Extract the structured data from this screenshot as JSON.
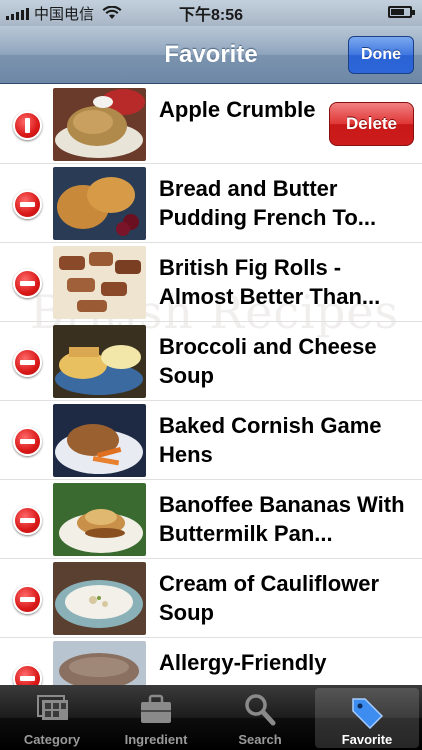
{
  "status_bar": {
    "carrier": "中国电信",
    "time": "下午8:56",
    "battery_level": 0.7
  },
  "nav": {
    "title": "Favorite",
    "done_label": "Done"
  },
  "watermark": "British Recipes",
  "list": {
    "delete_label": "Delete",
    "items": [
      {
        "title": "Apple Crumble"
      },
      {
        "title": "Bread and Butter Pudding French To..."
      },
      {
        "title": "British Fig Rolls - Almost Better Than..."
      },
      {
        "title": "Broccoli and Cheese Soup"
      },
      {
        "title": "Baked Cornish Game Hens"
      },
      {
        "title": "Banoffee Bananas With Buttermilk Pan..."
      },
      {
        "title": "Cream of Cauliflower Soup"
      },
      {
        "title": "Allergy-Friendly"
      }
    ]
  },
  "tabs": [
    {
      "label": "Category",
      "icon": "category-icon"
    },
    {
      "label": "Ingredient",
      "icon": "briefcase-icon"
    },
    {
      "label": "Search",
      "icon": "search-icon"
    },
    {
      "label": "Favorite",
      "icon": "tag-icon"
    }
  ],
  "colors": {
    "nav_bar": "#7b93ae",
    "done_button": "#3f76df",
    "delete_red": "#d91818",
    "tab_bar": "#1c1c1c"
  }
}
